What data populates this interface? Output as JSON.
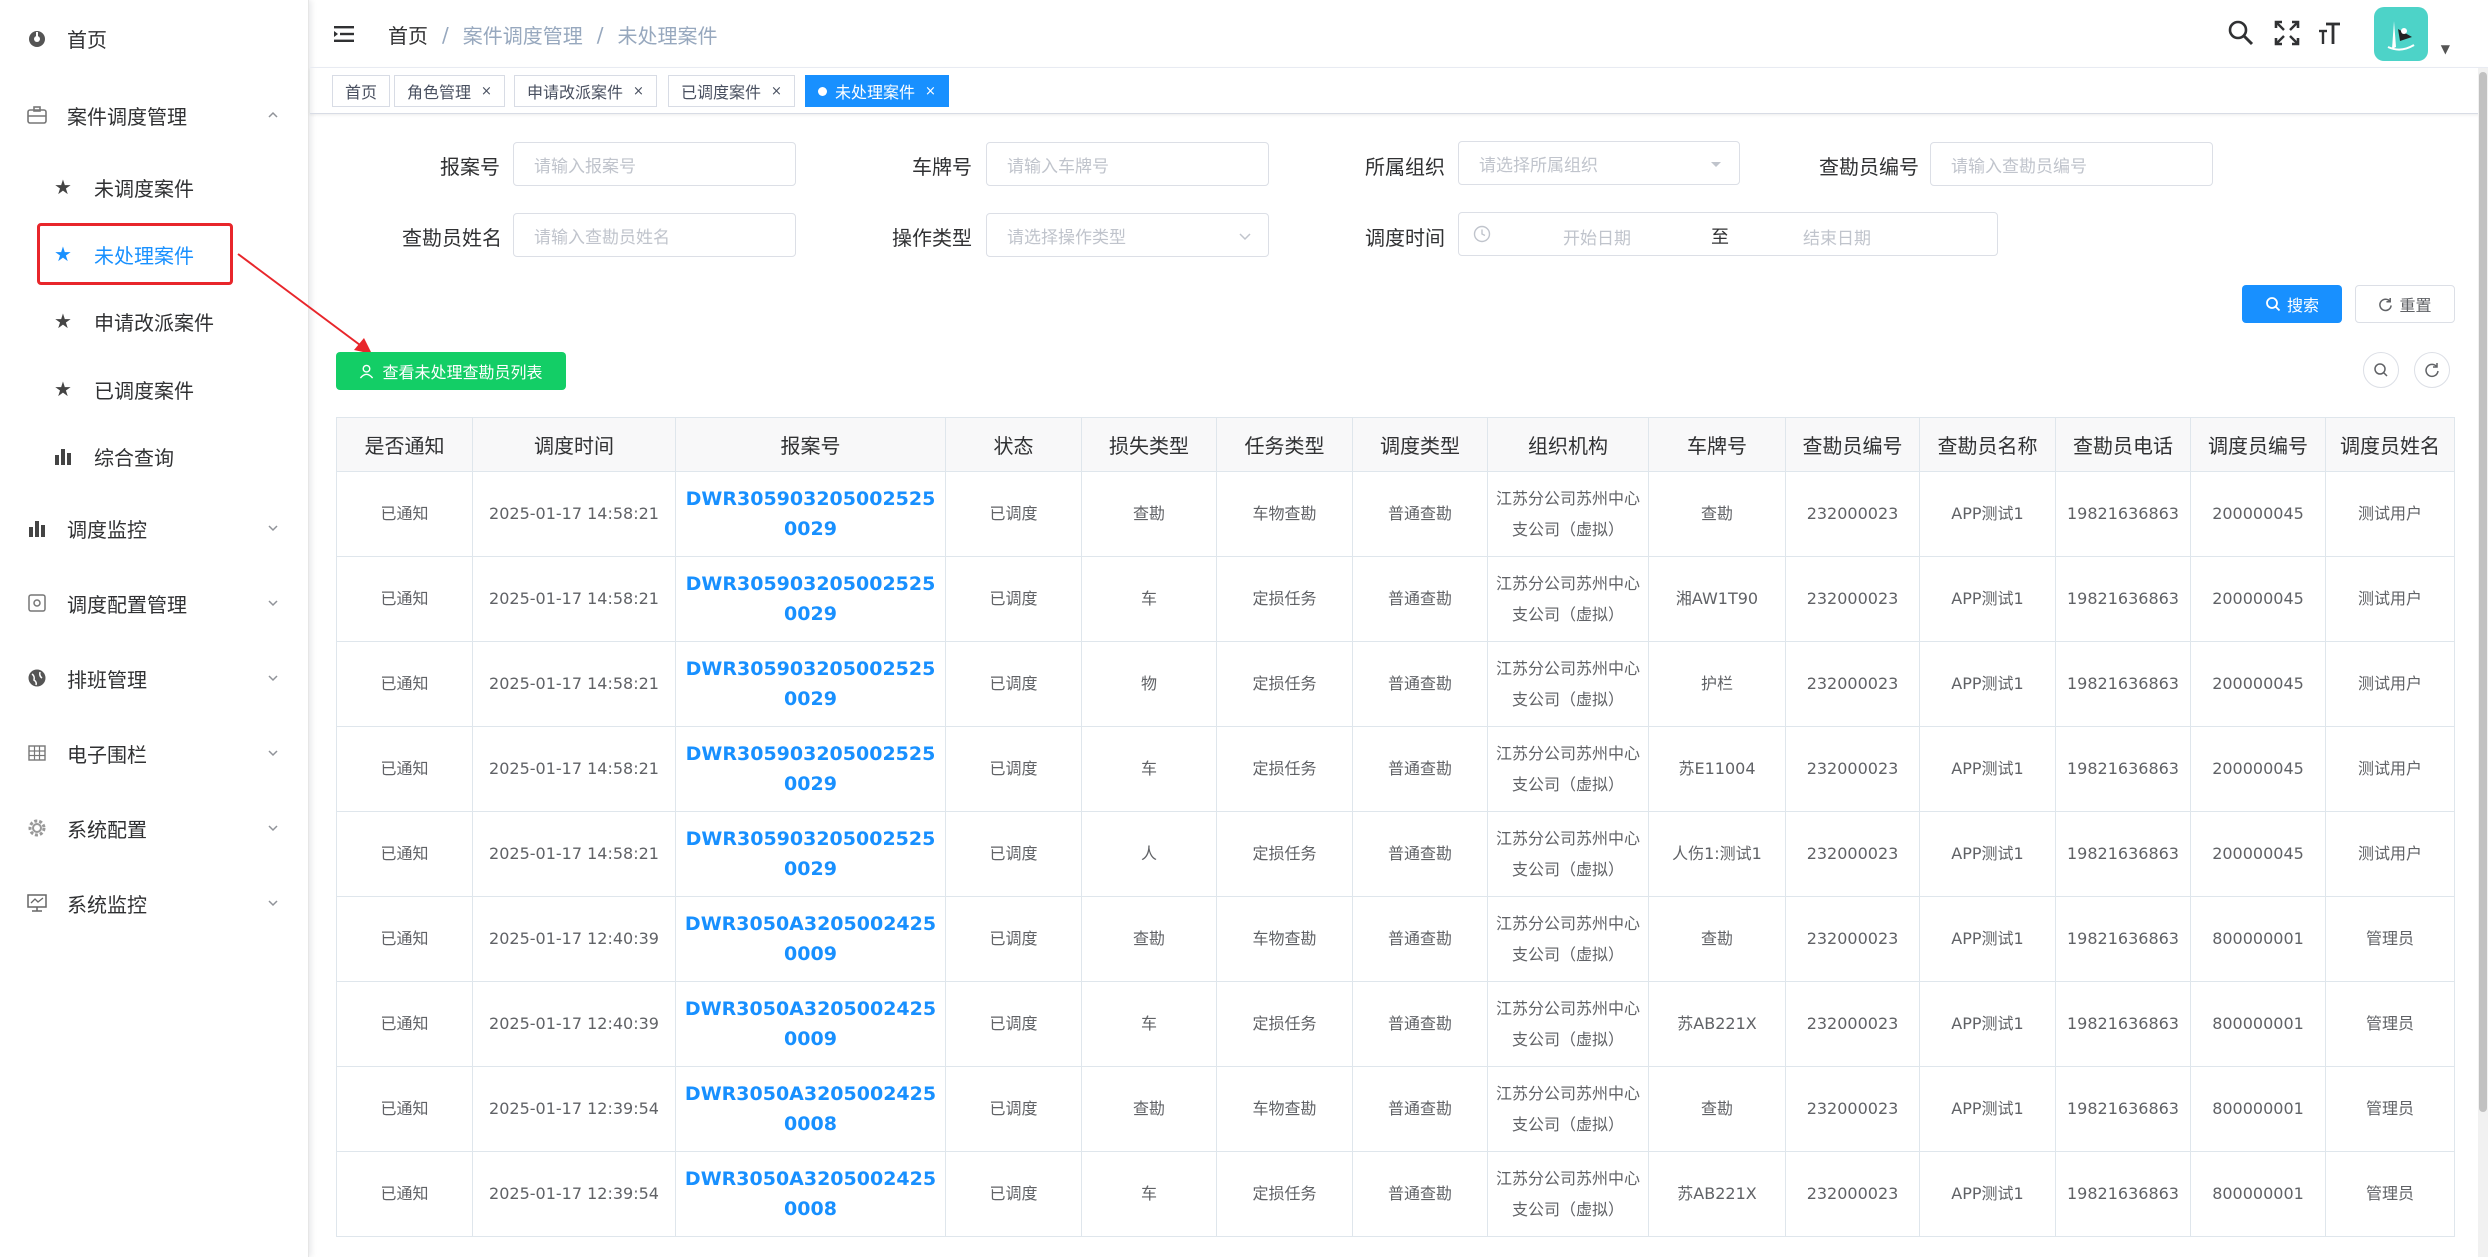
{
  "sidebar": {
    "items": [
      {
        "label": "首页",
        "icon": "dashboard-icon"
      },
      {
        "label": "案件调度管理",
        "icon": "briefcase-icon"
      },
      {
        "label": "调度监控",
        "icon": "bar-chart-icon"
      },
      {
        "label": "调度配置管理",
        "icon": "config-icon"
      },
      {
        "label": "排班管理",
        "icon": "globe-icon"
      },
      {
        "label": "电子围栏",
        "icon": "grid-icon"
      },
      {
        "label": "系统配置",
        "icon": "gear-icon"
      },
      {
        "label": "系统监控",
        "icon": "monitor-icon"
      }
    ],
    "subitems": [
      {
        "label": "未调度案件",
        "icon": "star-icon"
      },
      {
        "label": "未处理案件",
        "icon": "star-icon"
      },
      {
        "label": "申请改派案件",
        "icon": "star-icon"
      },
      {
        "label": "已调度案件",
        "icon": "star-icon"
      },
      {
        "label": "综合查询",
        "icon": "bar-chart-icon"
      }
    ]
  },
  "header": {
    "breadcrumb": [
      "首页",
      "案件调度管理",
      "未处理案件"
    ],
    "sep": "/"
  },
  "tags": [
    {
      "label": "首页"
    },
    {
      "label": "角色管理",
      "close": "×"
    },
    {
      "label": "申请改派案件",
      "close": "×"
    },
    {
      "label": "已调度案件",
      "close": "×"
    },
    {
      "label": "未处理案件",
      "close": "×"
    }
  ],
  "form": {
    "case_no": {
      "label": "报案号",
      "placeholder": "请输入报案号"
    },
    "plate": {
      "label": "车牌号",
      "placeholder": "请输入车牌号"
    },
    "org": {
      "label": "所属组织",
      "placeholder": "请选择所属组织"
    },
    "surveyor_no": {
      "label": "查勘员编号",
      "placeholder": "请输入查勘员编号"
    },
    "surveyor_name": {
      "label": "查勘员姓名",
      "placeholder": "请输入查勘员姓名"
    },
    "op_type": {
      "label": "操作类型",
      "placeholder": "请选择操作类型"
    },
    "dispatch_time": {
      "label": "调度时间",
      "start": "开始日期",
      "to": "至",
      "end": "结束日期"
    }
  },
  "buttons": {
    "search": "搜索",
    "reset": "重置",
    "view_list": "查看未处理查勘员列表"
  },
  "table": {
    "headers": [
      "是否通知",
      "调度时间",
      "报案号",
      "状态",
      "损失类型",
      "任务类型",
      "调度类型",
      "组织机构",
      "车牌号",
      "查勘员编号",
      "查勘员名称",
      "查勘员电话",
      "调度员编号",
      "调度员姓名"
    ],
    "rows": [
      [
        "已通知",
        "2025-01-17 14:58:21",
        "DWR3059032050025250029",
        "已调度",
        "查勘",
        "车物查勘",
        "普通查勘",
        "江苏分公司苏州中心支公司（虚拟）",
        "查勘",
        "232000023",
        "APP测试1",
        "19821636863",
        "200000045",
        "测试用户"
      ],
      [
        "已通知",
        "2025-01-17 14:58:21",
        "DWR3059032050025250029",
        "已调度",
        "车",
        "定损任务",
        "普通查勘",
        "江苏分公司苏州中心支公司（虚拟）",
        "湘AW1T90",
        "232000023",
        "APP测试1",
        "19821636863",
        "200000045",
        "测试用户"
      ],
      [
        "已通知",
        "2025-01-17 14:58:21",
        "DWR3059032050025250029",
        "已调度",
        "物",
        "定损任务",
        "普通查勘",
        "江苏分公司苏州中心支公司（虚拟）",
        "护栏",
        "232000023",
        "APP测试1",
        "19821636863",
        "200000045",
        "测试用户"
      ],
      [
        "已通知",
        "2025-01-17 14:58:21",
        "DWR3059032050025250029",
        "已调度",
        "车",
        "定损任务",
        "普通查勘",
        "江苏分公司苏州中心支公司（虚拟）",
        "苏E11004",
        "232000023",
        "APP测试1",
        "19821636863",
        "200000045",
        "测试用户"
      ],
      [
        "已通知",
        "2025-01-17 14:58:21",
        "DWR3059032050025250029",
        "已调度",
        "人",
        "定损任务",
        "普通查勘",
        "江苏分公司苏州中心支公司（虚拟）",
        "人伤1:测试1",
        "232000023",
        "APP测试1",
        "19821636863",
        "200000045",
        "测试用户"
      ],
      [
        "已通知",
        "2025-01-17 12:40:39",
        "DWR3050A32050024250009",
        "已调度",
        "查勘",
        "车物查勘",
        "普通查勘",
        "江苏分公司苏州中心支公司（虚拟）",
        "查勘",
        "232000023",
        "APP测试1",
        "19821636863",
        "800000001",
        "管理员"
      ],
      [
        "已通知",
        "2025-01-17 12:40:39",
        "DWR3050A32050024250009",
        "已调度",
        "车",
        "定损任务",
        "普通查勘",
        "江苏分公司苏州中心支公司（虚拟）",
        "苏AB221X",
        "232000023",
        "APP测试1",
        "19821636863",
        "800000001",
        "管理员"
      ],
      [
        "已通知",
        "2025-01-17 12:39:54",
        "DWR3050A32050024250008",
        "已调度",
        "查勘",
        "车物查勘",
        "普通查勘",
        "江苏分公司苏州中心支公司（虚拟）",
        "查勘",
        "232000023",
        "APP测试1",
        "19821636863",
        "800000001",
        "管理员"
      ],
      [
        "已通知",
        "2025-01-17 12:39:54",
        "DWR3050A32050024250008",
        "已调度",
        "车",
        "定损任务",
        "普通查勘",
        "江苏分公司苏州中心支公司（虚拟）",
        "苏AB221X",
        "232000023",
        "APP测试1",
        "19821636863",
        "800000001",
        "管理员"
      ]
    ]
  },
  "colors": {
    "primary": "#1890ff",
    "success": "#13ce66",
    "annotation": "#e8262b"
  }
}
